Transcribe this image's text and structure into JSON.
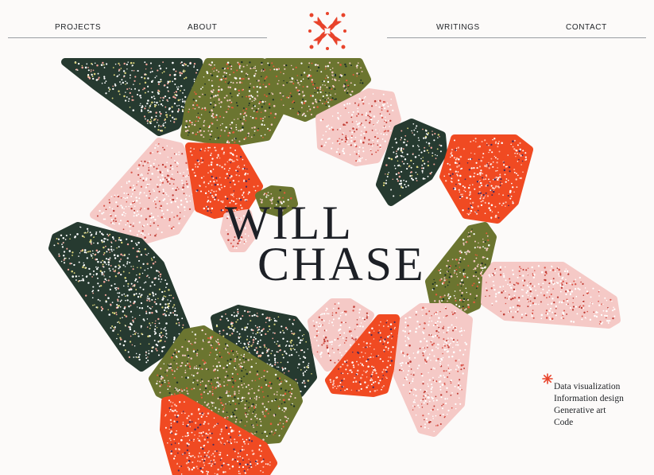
{
  "nav": {
    "left": [
      "PROJECTS",
      "ABOUT"
    ],
    "right": [
      "WRITINGS",
      "CONTACT"
    ]
  },
  "logo": {
    "icon": "floral-monogram-icon",
    "color": "#e8432b"
  },
  "title": {
    "line1": "WILL",
    "line2": "CHASE"
  },
  "services": {
    "icon": "asterisk-flower-icon",
    "items": [
      "Data visualization",
      "Information design",
      "Generative art",
      "Code"
    ]
  },
  "palette": {
    "dark_green": "#263a30",
    "olive": "#6b7530",
    "pink": "#f5c9c6",
    "red": "#f04a22"
  }
}
